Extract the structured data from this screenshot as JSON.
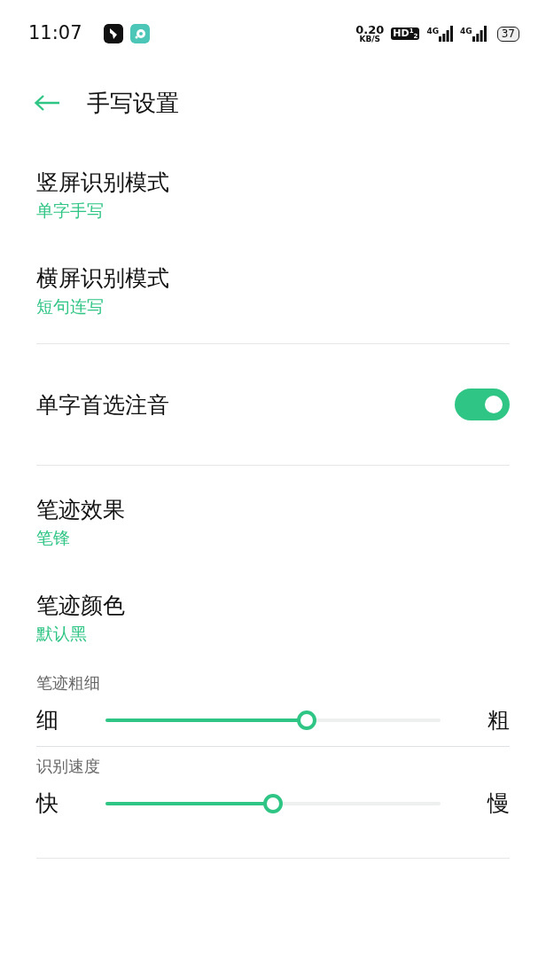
{
  "status_bar": {
    "time": "11:07",
    "net_speed": "0.20",
    "net_unit": "KB/S",
    "hd": "HD$^{1}$$_{2}$",
    "sim1": "4G",
    "sim2": "4G",
    "battery": "37"
  },
  "header": {
    "title": "手写设置"
  },
  "sections": [
    {
      "items": [
        {
          "kind": "option",
          "title": "竖屏识别模式",
          "value": "单字手写"
        },
        {
          "kind": "option",
          "title": "横屏识别模式",
          "value": "短句连写"
        }
      ]
    },
    {
      "items": [
        {
          "kind": "toggle",
          "title": "单字首选注音",
          "on": true
        }
      ]
    },
    {
      "items": [
        {
          "kind": "option",
          "title": "笔迹效果",
          "value": "笔锋"
        },
        {
          "kind": "option",
          "title": "笔迹颜色",
          "value": "默认黑"
        },
        {
          "kind": "slider",
          "title": "笔迹粗细",
          "min_label": "细",
          "max_label": "粗",
          "level": 0.6
        },
        {
          "kind": "slider",
          "title": "识别速度",
          "min_label": "快",
          "max_label": "慢",
          "level": 0.5
        }
      ]
    }
  ]
}
